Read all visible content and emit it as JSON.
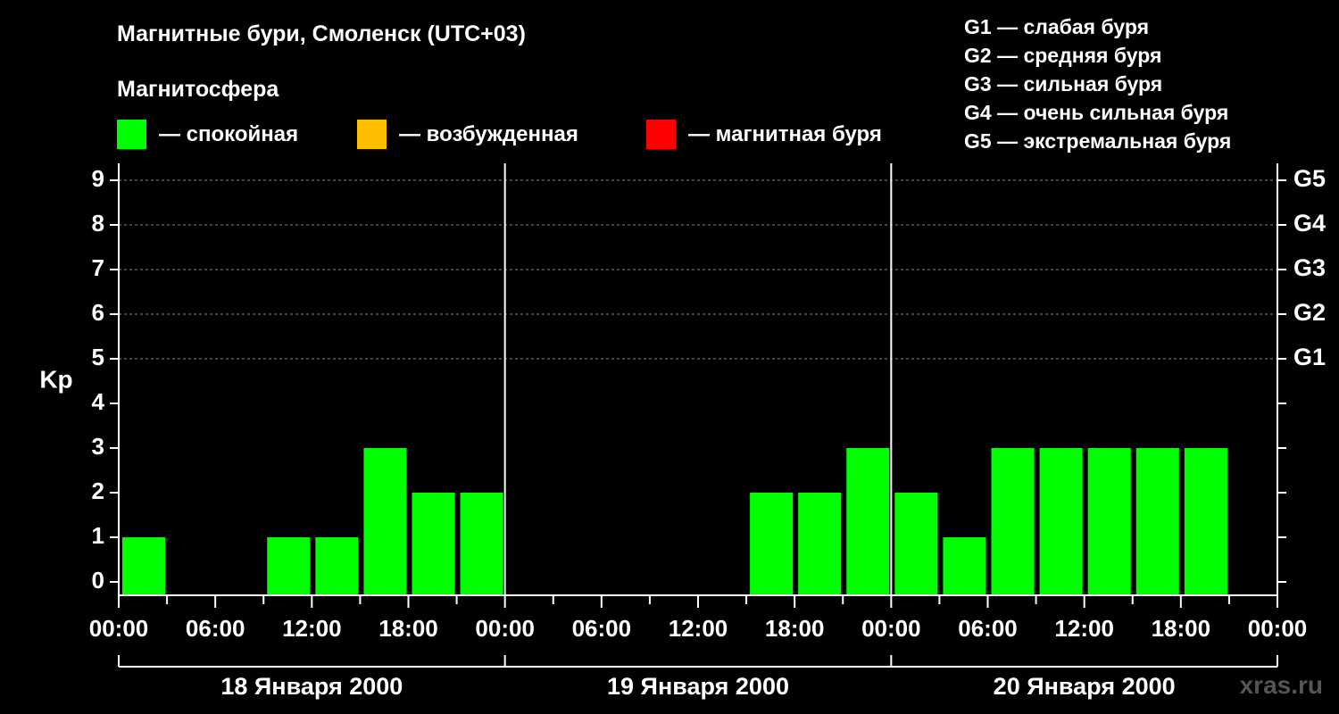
{
  "title": "Магнитные бури, Смоленск (UTC+03)",
  "subtitle": "Магнитосфера",
  "legend": [
    {
      "label": "— спокойная",
      "color": "#00ff00"
    },
    {
      "label": "— возбужденная",
      "color": "#ffbf00"
    },
    {
      "label": "— магнитная буря",
      "color": "#ff0000"
    }
  ],
  "storm_scale": [
    "G1 — слабая буря",
    "G2 — средняя буря",
    "G3 — сильная буря",
    "G4 — очень сильная буря",
    "G5 — экстремальная буря"
  ],
  "watermark": "xras.ru",
  "chart_data": {
    "type": "bar",
    "ylabel": "Kp",
    "ylim": [
      0,
      9
    ],
    "yticks": [
      "0",
      "1",
      "2",
      "3",
      "4",
      "5",
      "6",
      "7",
      "8",
      "9"
    ],
    "g_levels": [
      {
        "kp": 5,
        "label": "G1"
      },
      {
        "kp": 6,
        "label": "G2"
      },
      {
        "kp": 7,
        "label": "G3"
      },
      {
        "kp": 8,
        "label": "G4"
      },
      {
        "kp": 9,
        "label": "G5"
      }
    ],
    "grid": "horizontal dashed at Kp 5-9",
    "xtick_labels": [
      "00:00",
      "06:00",
      "12:00",
      "18:00",
      "00:00",
      "06:00",
      "12:00",
      "18:00",
      "00:00",
      "06:00",
      "12:00",
      "18:00",
      "00:00"
    ],
    "days": [
      "18 Января 2000",
      "19 Января 2000",
      "20 Января 2000"
    ],
    "interval_hours": 3,
    "series": [
      {
        "values": [
          1,
          0,
          0,
          1,
          1,
          3,
          2,
          2,
          0,
          0,
          0,
          0,
          0,
          2,
          2,
          3,
          2,
          1,
          3,
          3,
          3,
          3,
          3
        ]
      }
    ],
    "bar_color": "#00ff00"
  }
}
